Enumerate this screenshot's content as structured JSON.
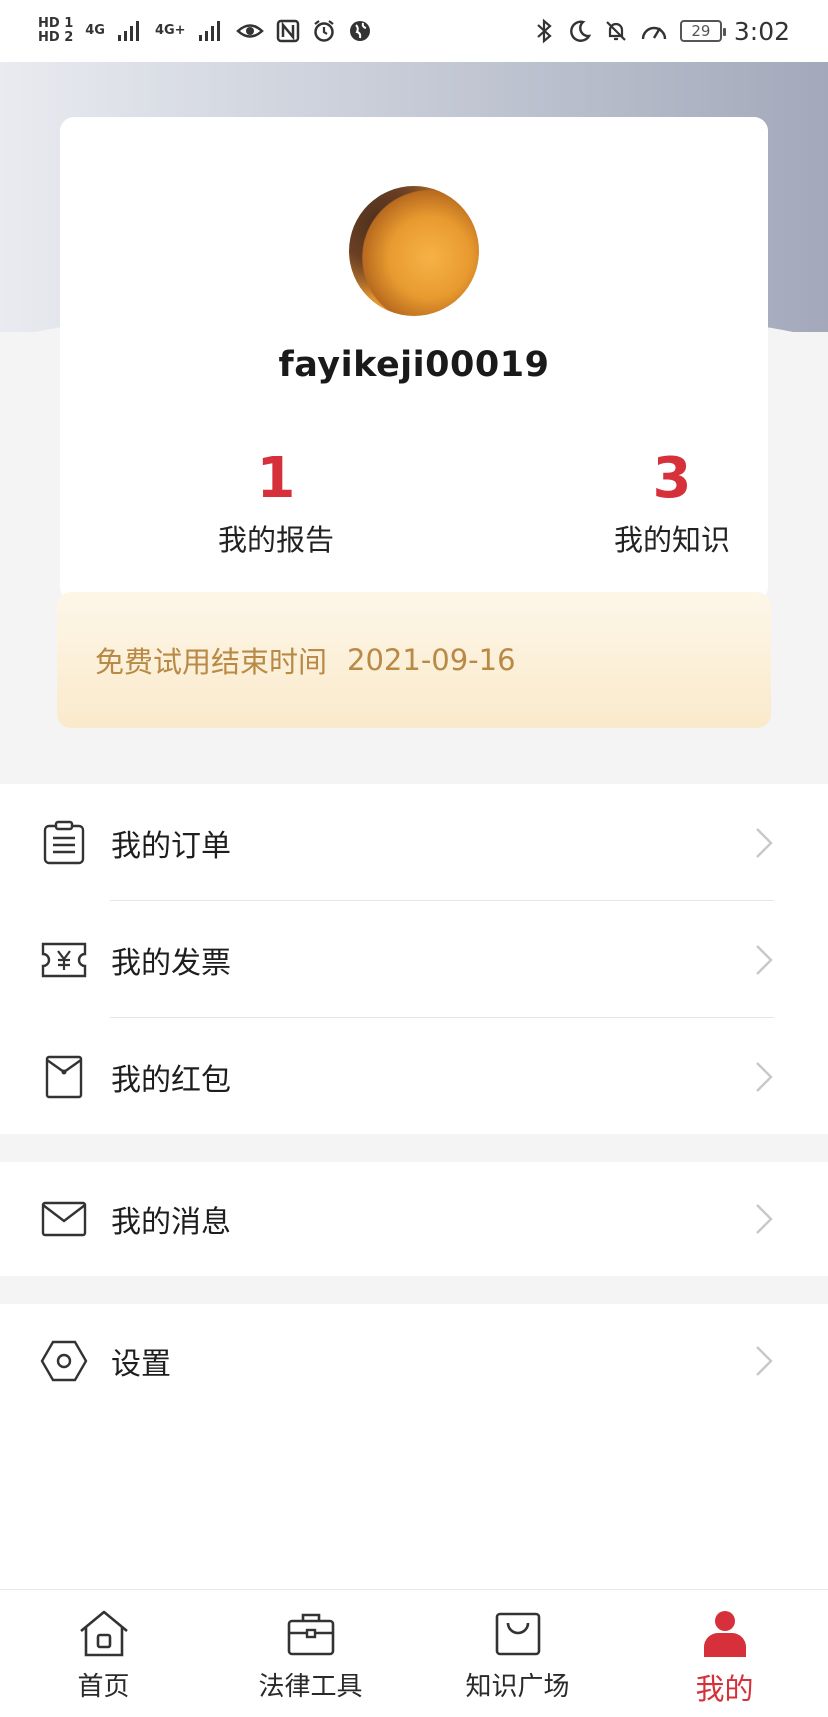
{
  "status_bar": {
    "left_badges": [
      "HD 1",
      "HD 2"
    ],
    "network_1": "4G",
    "network_2": "4G+",
    "battery_level": "29",
    "time": "3:02",
    "icons": [
      "signal-icon",
      "eye-icon",
      "nfc-icon",
      "alarm-icon",
      "globe-icon",
      "bluetooth-icon",
      "moon-icon",
      "mute-bell-icon",
      "speed-icon",
      "battery-icon"
    ]
  },
  "profile": {
    "username": "fayikeji00019",
    "stats": [
      {
        "value": "1",
        "label": "我的报告"
      },
      {
        "value": "3",
        "label": "我的知识"
      }
    ]
  },
  "trial": {
    "label": "免费试用结束时间",
    "date": "2021-09-16"
  },
  "menu": {
    "orders": {
      "label": "我的订单",
      "icon": "clipboard-icon"
    },
    "invoices": {
      "label": "我的发票",
      "icon": "invoice-ticket-icon"
    },
    "red_packets": {
      "label": "我的红包",
      "icon": "red-envelope-icon"
    },
    "messages": {
      "label": "我的消息",
      "icon": "mail-icon"
    },
    "settings": {
      "label": "设置",
      "icon": "hexagon-settings-icon"
    }
  },
  "bottom_nav": {
    "items": [
      {
        "label": "首页",
        "icon": "home-icon",
        "active": false
      },
      {
        "label": "法律工具",
        "icon": "briefcase-icon",
        "active": false
      },
      {
        "label": "知识广场",
        "icon": "shopping-bag-icon",
        "active": false
      },
      {
        "label": "我的",
        "icon": "user-icon",
        "active": true
      }
    ]
  },
  "colors": {
    "accent_red": "#d6313a",
    "trial_text": "#b88a46",
    "trial_bg": "#fbefd6"
  }
}
